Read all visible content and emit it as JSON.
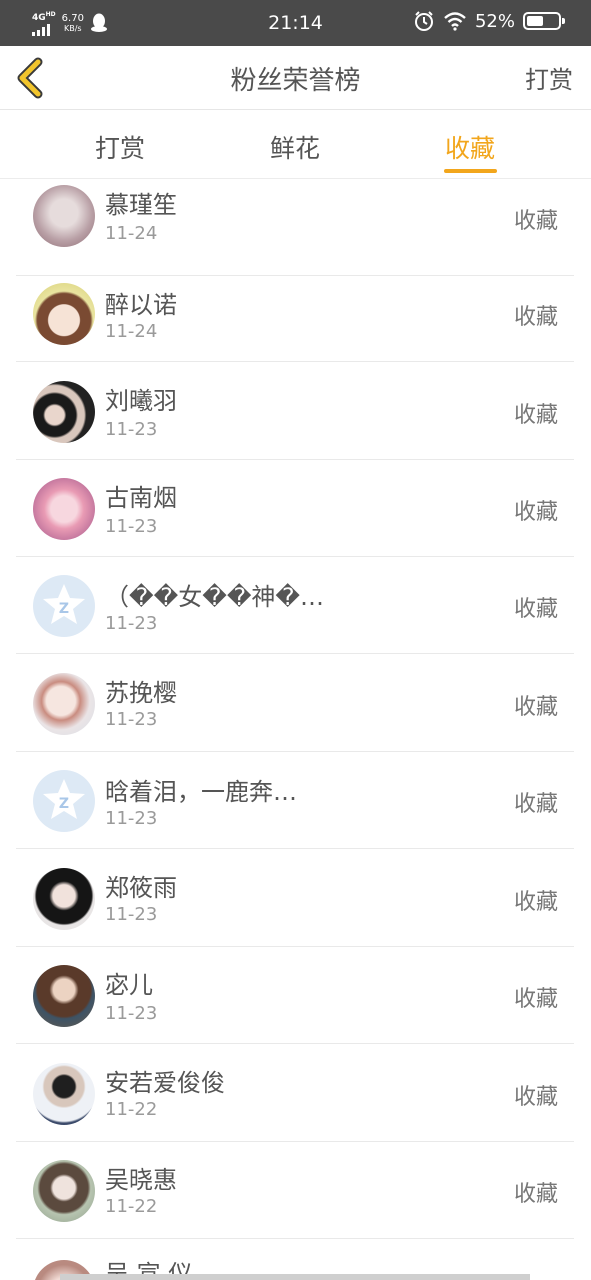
{
  "status_bar": {
    "network": "4G",
    "network_sup": "HD",
    "speed_value": "6.70",
    "speed_unit": "KB/s",
    "time": "21:14",
    "battery_pct": "52%",
    "battery_level": 0.52
  },
  "header": {
    "title": "粉丝荣誉榜",
    "action": "打赏"
  },
  "tabs": [
    {
      "label": "打赏",
      "active": false
    },
    {
      "label": "鲜花",
      "active": false
    },
    {
      "label": "收藏",
      "active": true
    }
  ],
  "accent_color": "#f2a61c",
  "fans": [
    {
      "name": "慕瑾笙",
      "date": "11-24",
      "action": "收藏",
      "avatar": "photo"
    },
    {
      "name": "醉以诺",
      "date": "11-24",
      "action": "收藏",
      "avatar": "photo"
    },
    {
      "name": "刘曦羽",
      "date": "11-23",
      "action": "收藏",
      "avatar": "photo"
    },
    {
      "name": "古南烟",
      "date": "11-23",
      "action": "收藏",
      "avatar": "photo"
    },
    {
      "name": "（��女��神�…",
      "date": "11-23",
      "action": "收藏",
      "avatar": "default-qq-icon"
    },
    {
      "name": "苏挽樱",
      "date": "11-23",
      "action": "收藏",
      "avatar": "photo"
    },
    {
      "name": "晗着泪，一鹿奔…",
      "date": "11-23",
      "action": "收藏",
      "avatar": "default-qq-icon"
    },
    {
      "name": "郑筱雨",
      "date": "11-23",
      "action": "收藏",
      "avatar": "photo"
    },
    {
      "name": "宓儿",
      "date": "11-23",
      "action": "收藏",
      "avatar": "photo"
    },
    {
      "name": "安若爱俊俊",
      "date": "11-22",
      "action": "收藏",
      "avatar": "photo"
    },
    {
      "name": "吴晓惠",
      "date": "11-22",
      "action": "收藏",
      "avatar": "photo"
    },
    {
      "name": "吴 宣 仪",
      "date": "",
      "action": "",
      "avatar": "photo"
    }
  ]
}
